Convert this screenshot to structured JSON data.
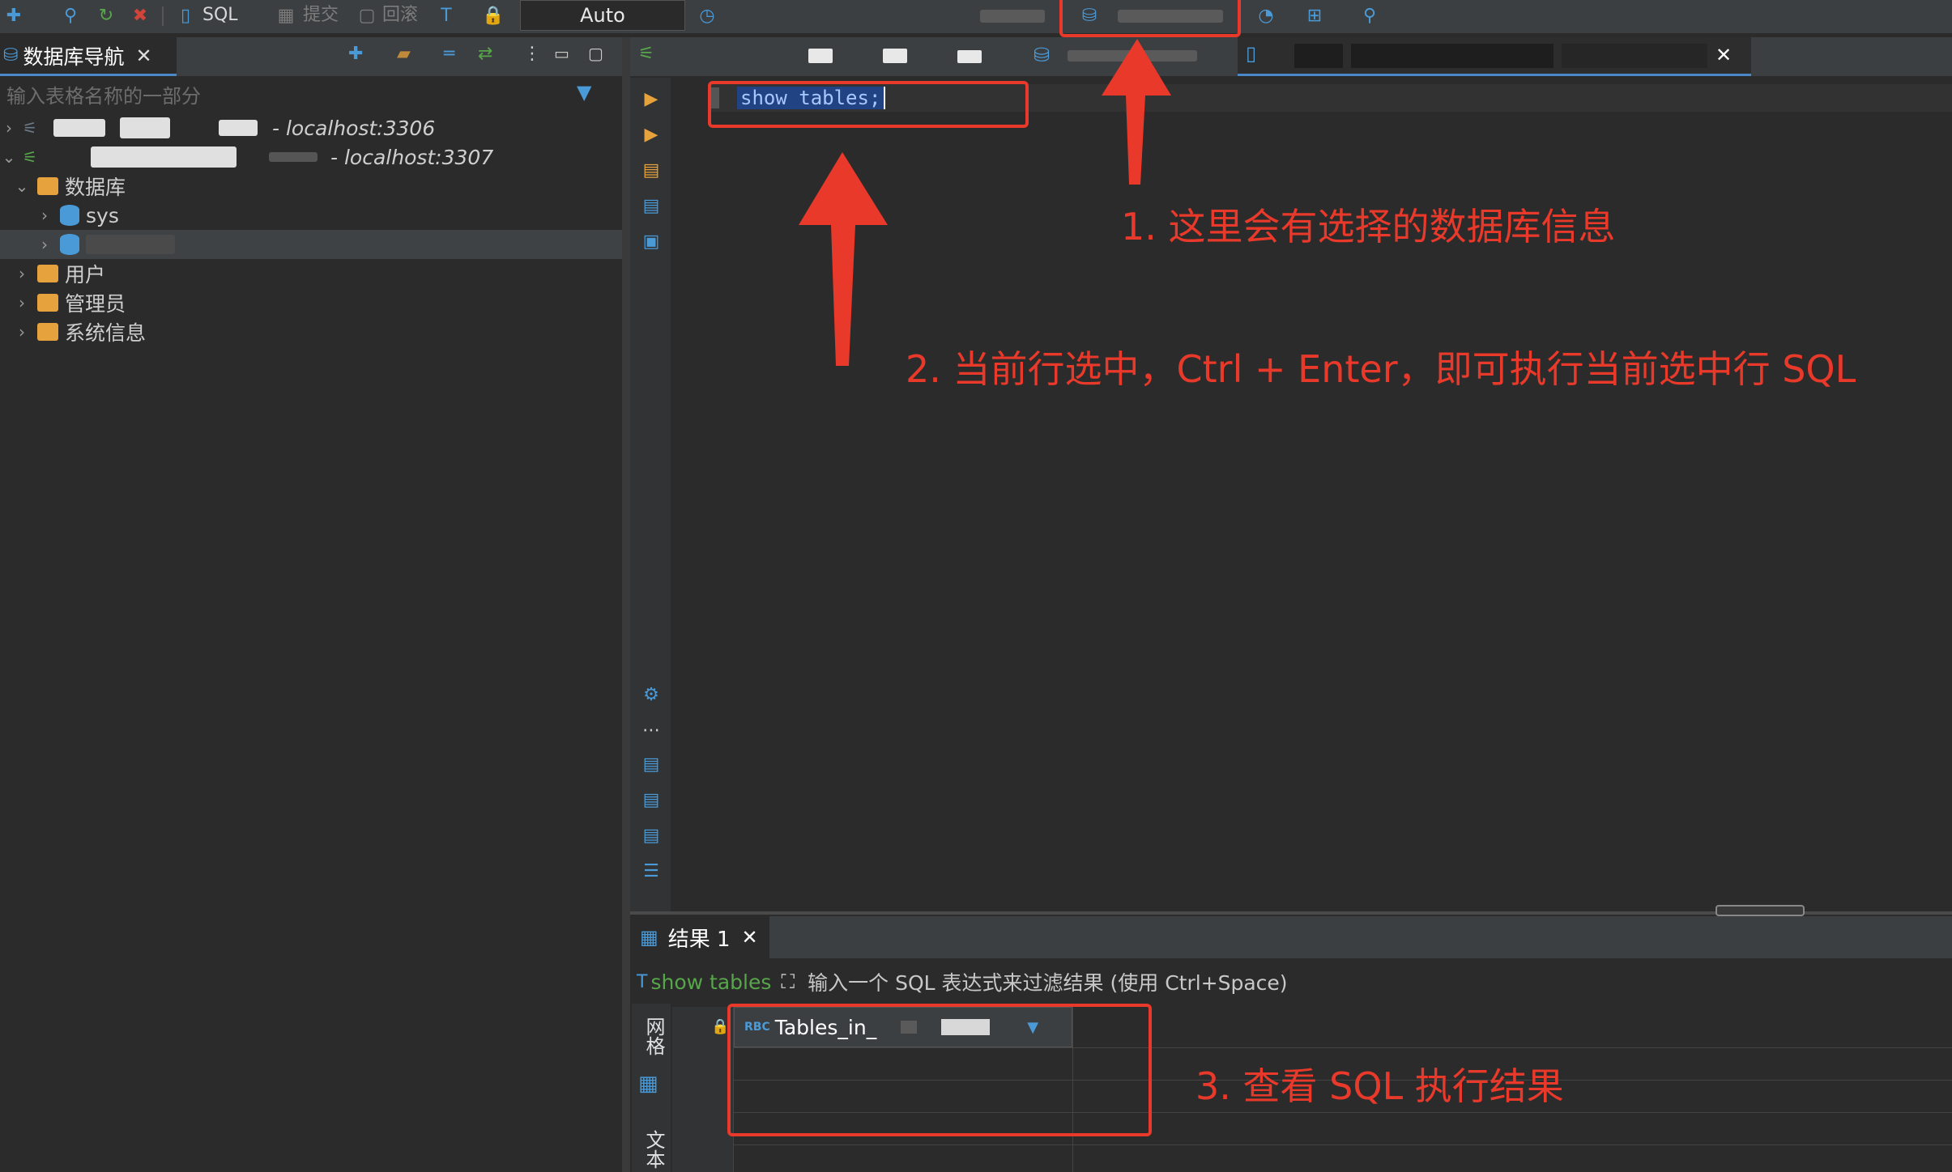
{
  "toolbar": {
    "sql_label": "SQL",
    "commit_label": "提交",
    "rollback_label": "回滚",
    "transaction_mode": "Auto"
  },
  "navigator": {
    "tab_title": "数据库导航",
    "search_placeholder": "输入表格名称的一部分",
    "connections": [
      {
        "host": "- localhost:3306"
      },
      {
        "host": "- localhost:3307"
      }
    ],
    "folders": {
      "databases": "数据库",
      "users": "用户",
      "admins": "管理员",
      "system_info": "系统信息"
    },
    "schemas": [
      "sys"
    ]
  },
  "editor": {
    "sql_text": "show tables;"
  },
  "results": {
    "tab_label": "结果 1",
    "query_label": "show tables",
    "filter_hint": "输入一个 SQL 表达式来过滤结果 (使用 Ctrl+Space)",
    "column_type_badge": "RBC",
    "column_header": "Tables_in_",
    "side_tab_grid": "网格",
    "side_tab_text": "文本"
  },
  "annotations": {
    "note1": "1. 这里会有选择的数据库信息",
    "note2": "2. 当前行选中，Ctrl + Enter，即可执行当前选中行 SQL",
    "note3": "3. 查看 SQL 执行结果"
  },
  "colors": {
    "annotation_red": "#e8392a",
    "accent_blue": "#4a88c7",
    "folder_orange": "#e6a23c",
    "db_blue": "#4a9ad8"
  }
}
